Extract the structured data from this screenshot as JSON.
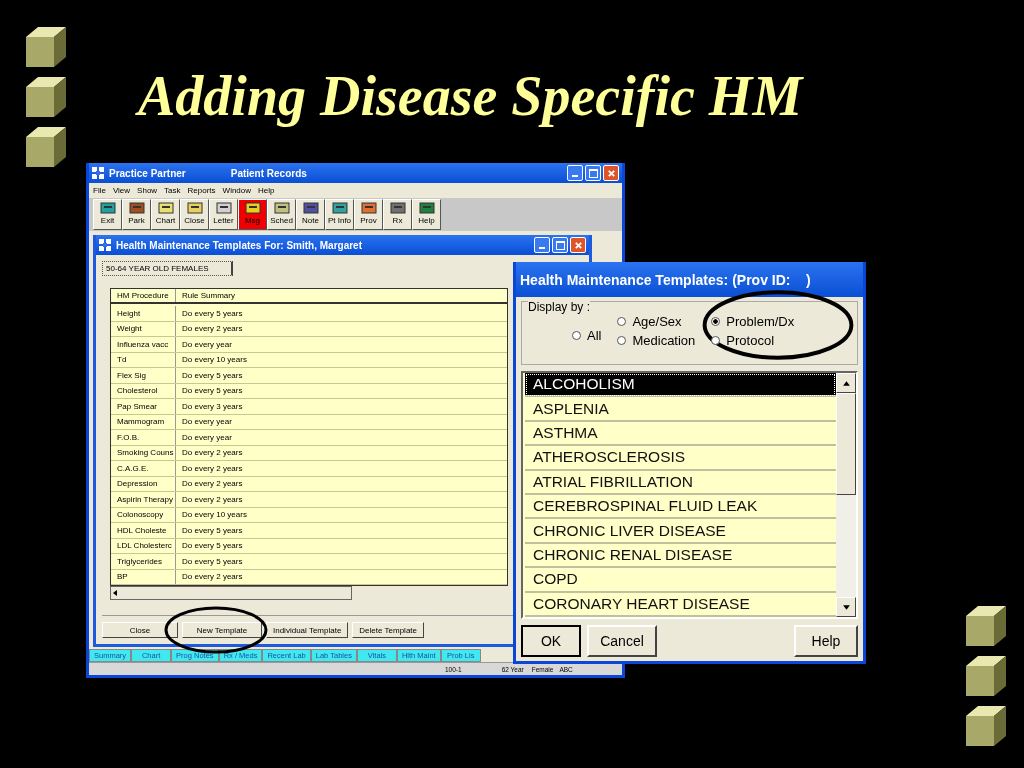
{
  "slide_title": "Adding Disease Specific HM",
  "main_window": {
    "title": "Practice Partner",
    "subtitle": "Patient Records",
    "menu": [
      "File",
      "View",
      "Show",
      "Task",
      "Reports",
      "Window",
      "Help"
    ],
    "toolbar": [
      {
        "label": "Exit",
        "highlighted": false
      },
      {
        "label": "Park",
        "highlighted": false
      },
      {
        "label": "Chart",
        "highlighted": false
      },
      {
        "label": "Close",
        "highlighted": false
      },
      {
        "label": "Letter",
        "highlighted": false
      },
      {
        "label": "Msg",
        "highlighted": true
      },
      {
        "label": "Sched",
        "highlighted": false
      },
      {
        "label": "Note",
        "highlighted": false
      },
      {
        "label": "Pt Info",
        "highlighted": false
      },
      {
        "label": "Prov",
        "highlighted": false
      },
      {
        "label": "Rx",
        "highlighted": false
      },
      {
        "label": "Help",
        "highlighted": false
      }
    ],
    "tabs": [
      {
        "label": "Summary",
        "selected": false
      },
      {
        "label": "Chart",
        "selected": false
      },
      {
        "label": "Prog Notes",
        "selected": false
      },
      {
        "label": "Rx / Meds",
        "selected": false
      },
      {
        "label": "Recent Lab",
        "selected": false
      },
      {
        "label": "Lab Tables",
        "selected": false
      },
      {
        "label": "Vitals",
        "selected": false
      },
      {
        "label": "Hlth Maint",
        "selected": false
      },
      {
        "label": "Prob Lis",
        "selected": false
      }
    ],
    "status_bar": [
      "100-1",
      "62 Year",
      "Female",
      "ABC"
    ]
  },
  "templates_window": {
    "title": "Health Maintenance Templates For: Smith, Margaret",
    "group_tab": "50-64 YEAR OLD FEMALES",
    "table": {
      "columns": [
        "HM Procedure",
        "Rule Summary"
      ],
      "rows": [
        [
          "Height",
          "Do every 5 years"
        ],
        [
          "Weight",
          "Do every 2 years"
        ],
        [
          "Influenza vacc",
          "Do every year"
        ],
        [
          "Td",
          "Do every 10 years"
        ],
        [
          "Flex Sig",
          "Do every 5 years"
        ],
        [
          "Cholesterol",
          "Do every 5 years"
        ],
        [
          "Pap Smear",
          "Do every 3 years"
        ],
        [
          "Mammogram",
          "Do every year"
        ],
        [
          "F.O.B.",
          "Do every year"
        ],
        [
          "Smoking Couns",
          "Do every 2 years"
        ],
        [
          "C.A.G.E.",
          "Do every 2 years"
        ],
        [
          "Depression",
          "Do every 2 years"
        ],
        [
          "Aspirin Therapy",
          "Do every 2 years"
        ],
        [
          "Colonoscopy",
          "Do every 10 years"
        ],
        [
          "HDL Choleste",
          "Do every 5 years"
        ],
        [
          "LDL Cholesterc",
          "Do every 5 years"
        ],
        [
          "Triglycerides",
          "Do every 5 years"
        ],
        [
          "BP",
          "Do every 2 years"
        ]
      ]
    },
    "buttons": [
      "Close",
      "New Template",
      "Individual Template",
      "Delete Template"
    ]
  },
  "dialog": {
    "title": "Health Maintenance Templates: (Prov ID:    )",
    "group_label": "Display by :",
    "options": [
      {
        "label": "All",
        "selected": false
      },
      {
        "label": "Age/Sex",
        "selected": false
      },
      {
        "label": "Medication",
        "selected": false
      },
      {
        "label": "Problem/Dx",
        "selected": true
      },
      {
        "label": "Protocol",
        "selected": false
      }
    ],
    "list": [
      {
        "label": "ALCOHOLISM",
        "selected": true
      },
      {
        "label": "ASPLENIA",
        "selected": false
      },
      {
        "label": "ASTHMA",
        "selected": false
      },
      {
        "label": "ATHEROSCLEROSIS",
        "selected": false
      },
      {
        "label": "ATRIAL FIBRILLATION",
        "selected": false
      },
      {
        "label": "CEREBROSPINAL FLUID LEAK",
        "selected": false
      },
      {
        "label": "CHRONIC LIVER DISEASE",
        "selected": false
      },
      {
        "label": "CHRONIC RENAL DISEASE",
        "selected": false
      },
      {
        "label": "COPD",
        "selected": false
      },
      {
        "label": "CORONARY HEART DISEASE",
        "selected": false
      }
    ],
    "buttons": [
      "OK",
      "Cancel",
      "Help"
    ]
  }
}
